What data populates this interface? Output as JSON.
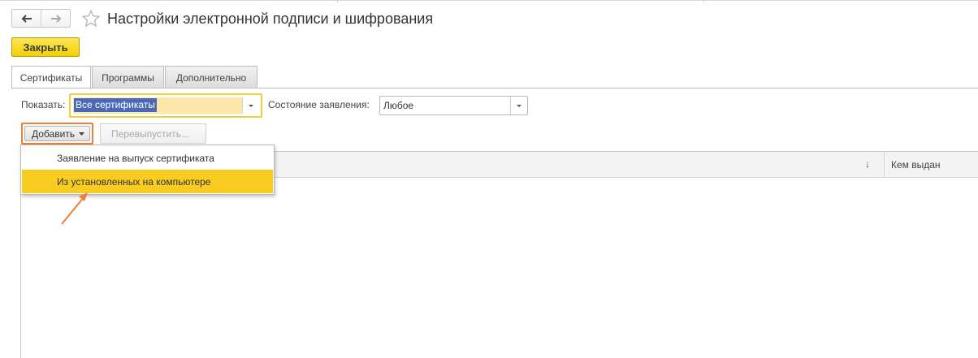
{
  "window": {
    "title": "Настройки электронной подписи и шифрования"
  },
  "toolbar": {
    "back_icon": "arrow-left-icon",
    "forward_icon": "arrow-right-icon",
    "favorite_icon": "star-icon",
    "close_label": "Закрыть"
  },
  "tabs": [
    {
      "label": "Сертификаты",
      "active": true
    },
    {
      "label": "Программы",
      "active": false
    },
    {
      "label": "Дополнительно",
      "active": false
    }
  ],
  "filters": {
    "show_label": "Показать:",
    "show_value": "Все сертификаты",
    "state_label": "Состояние заявления:",
    "state_value": "Любое"
  },
  "actions": {
    "add_label": "Добавить",
    "reissue_label": "Перевыпустить..."
  },
  "add_menu": {
    "items": [
      {
        "label": "Заявление на выпуск сертификата",
        "highlighted": false
      },
      {
        "label": "Из установленных на компьютере",
        "highlighted": true
      }
    ]
  },
  "table": {
    "sort_indicator": "↓",
    "columns": [
      "Кем выдан"
    ]
  },
  "colors": {
    "accent_yellow": "#f2d000",
    "menu_highlight": "#f8cc21",
    "annotation_orange": "#ef7d3c",
    "selection_blue": "#4a6ab8"
  }
}
